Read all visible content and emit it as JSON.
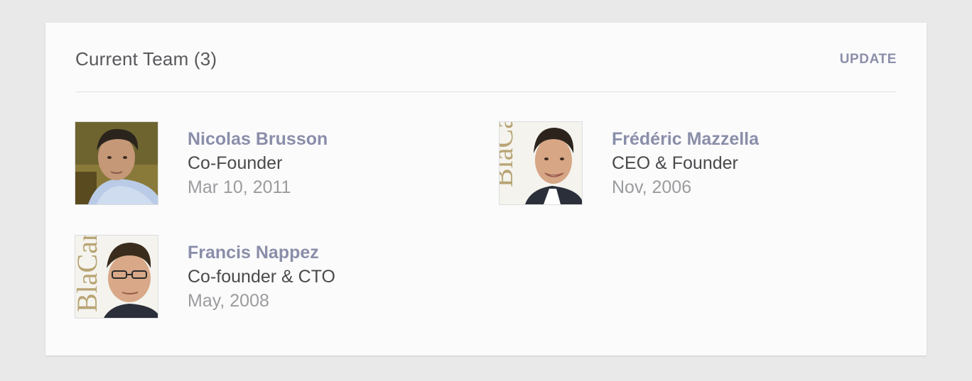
{
  "team": {
    "title": "Current Team (3)",
    "update_label": "UPDATE",
    "members": [
      {
        "name": "Nicolas Brusson",
        "role": "Co-Founder",
        "date": "Mar 10, 2011",
        "avatar_icon": "person-photo-icon"
      },
      {
        "name": "Frédéric Mazzella",
        "role": "CEO & Founder",
        "date": "Nov, 2006",
        "avatar_icon": "person-photo-icon",
        "avatar_logo_text": "BlaCar"
      },
      {
        "name": "Francis Nappez",
        "role": "Co-founder & CTO",
        "date": "May, 2008",
        "avatar_icon": "person-photo-icon",
        "avatar_logo_text": "BlaCar"
      }
    ]
  },
  "colors": {
    "page_bg": "#e9e9e9",
    "card_bg": "#fbfbfc",
    "accent_link": "#8a8ea9",
    "title_text": "#58595b",
    "role_text": "#4a4a4c",
    "date_text": "#9b9c9e",
    "logo_text": "#b8a473"
  }
}
